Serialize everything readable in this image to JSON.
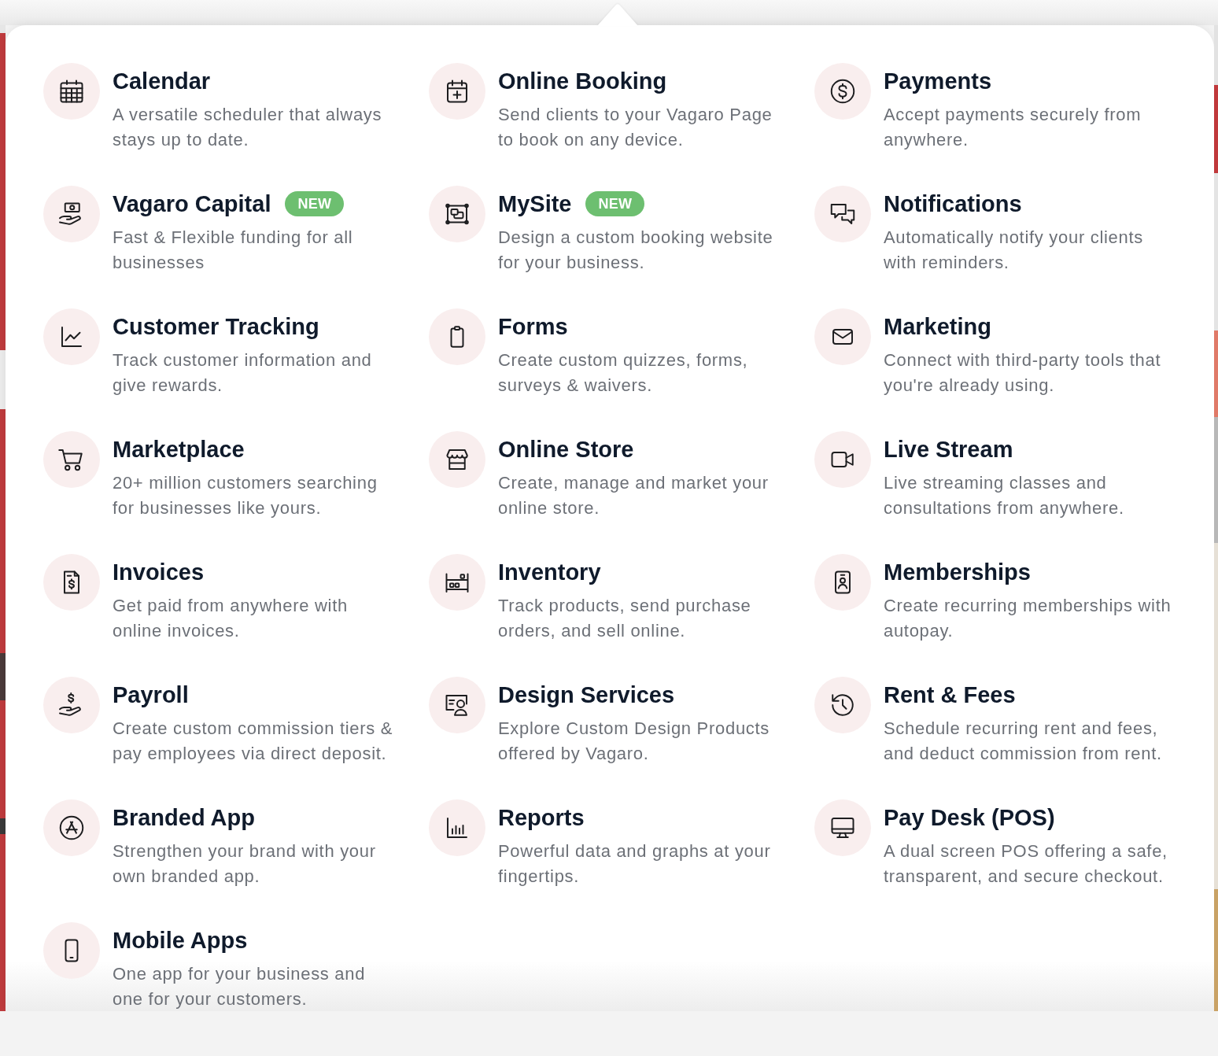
{
  "menu": {
    "items": [
      {
        "title": "Calendar",
        "description": "A versatile scheduler that always stays up to date."
      },
      {
        "title": "Online Booking",
        "description": "Send clients to your Vagaro Page to book on any device."
      },
      {
        "title": "Payments",
        "description": "Accept payments securely from anywhere."
      },
      {
        "title": "Vagaro Capital",
        "badge": "NEW",
        "description": "Fast & Flexible funding for all businesses"
      },
      {
        "title": "MySite",
        "badge": "NEW",
        "description": "Design a custom booking website for your business."
      },
      {
        "title": "Notifications",
        "description": "Automatically notify your clients with reminders."
      },
      {
        "title": "Customer Tracking",
        "description": "Track customer information and give rewards."
      },
      {
        "title": "Forms",
        "description": "Create custom quizzes, forms, surveys & waivers."
      },
      {
        "title": "Marketing",
        "description": "Connect with third-party tools that you're already using."
      },
      {
        "title": "Marketplace",
        "description": "20+ million customers searching for businesses like yours."
      },
      {
        "title": "Online Store",
        "description": "Create, manage and market your online store."
      },
      {
        "title": "Live Stream",
        "description": "Live streaming classes and consultations from anywhere."
      },
      {
        "title": "Invoices",
        "description": "Get paid from anywhere with online invoices."
      },
      {
        "title": "Inventory",
        "description": "Track products, send purchase orders, and sell online."
      },
      {
        "title": "Memberships",
        "description": "Create recurring memberships with autopay."
      },
      {
        "title": "Payroll",
        "description": "Create custom commission tiers & pay employees via direct deposit."
      },
      {
        "title": "Design Services",
        "description": "Explore Custom Design Products offered by Vagaro."
      },
      {
        "title": "Rent & Fees",
        "description": "Schedule recurring rent and fees, and deduct commission from rent."
      },
      {
        "title": "Branded App",
        "description": "Strengthen your brand with your own branded app."
      },
      {
        "title": "Reports",
        "description": "Powerful data and graphs at your fingertips."
      },
      {
        "title": "Pay Desk (POS)",
        "description": "A dual screen POS offering a safe, transparent, and secure checkout."
      },
      {
        "title": "Mobile Apps",
        "description": "One app for your business and one for your customers."
      }
    ]
  }
}
